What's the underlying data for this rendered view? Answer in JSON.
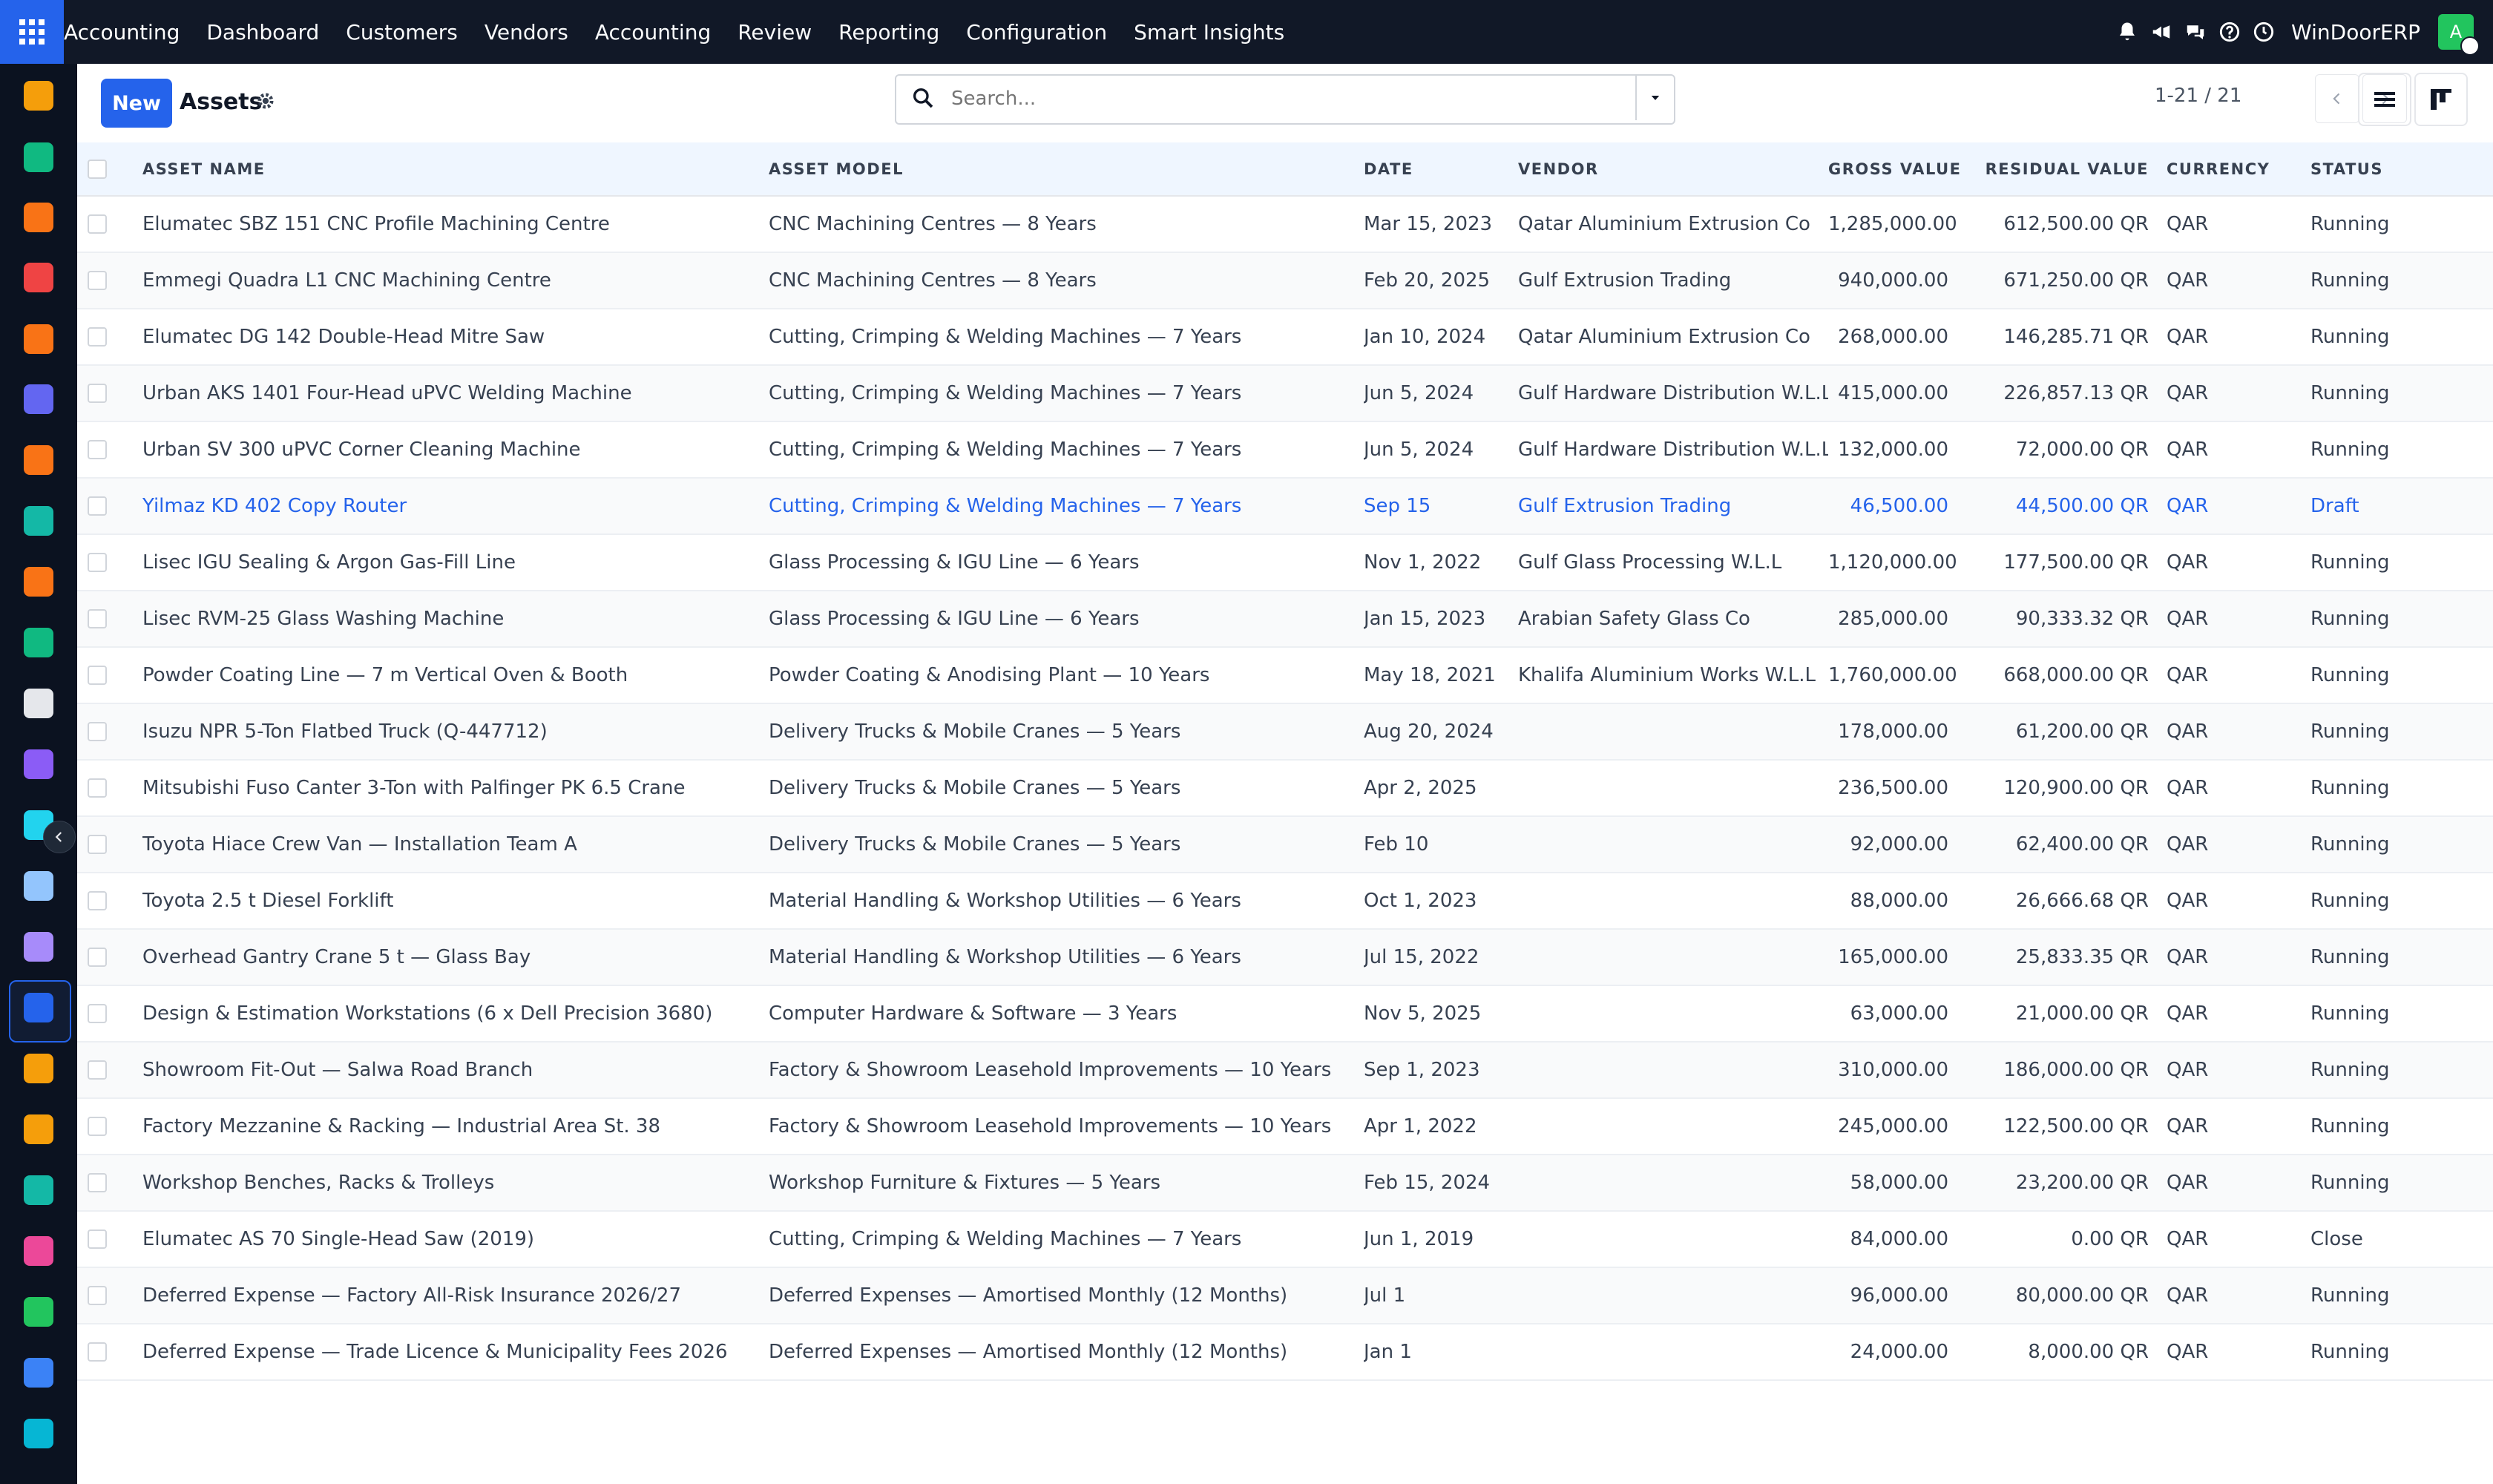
{
  "topbar": {
    "app_title": "Accounting",
    "menu": [
      "Dashboard",
      "Customers",
      "Vendors",
      "Accounting",
      "Review",
      "Reporting",
      "Configuration",
      "Smart Insights"
    ],
    "icons": [
      "bell-icon",
      "megaphone-icon",
      "chat-icon",
      "help-icon",
      "clock-icon"
    ],
    "company": "WinDoorERP",
    "avatar_initial": "A"
  },
  "colors": {
    "brand": "#2563eb",
    "topbar": "#111827",
    "sidebar": "#0b1220",
    "header_row": "#eff6ff"
  },
  "sidebar": {
    "apps": [
      {
        "name": "app-1",
        "color": "#f59e0b"
      },
      {
        "name": "app-2",
        "color": "#10b981"
      },
      {
        "name": "app-3",
        "color": "#f97316"
      },
      {
        "name": "app-4",
        "color": "#ef4444"
      },
      {
        "name": "app-5",
        "color": "#f97316"
      },
      {
        "name": "app-6",
        "color": "#6366f1"
      },
      {
        "name": "app-7",
        "color": "#f97316"
      },
      {
        "name": "app-8",
        "color": "#14b8a6"
      },
      {
        "name": "app-9",
        "color": "#f97316"
      },
      {
        "name": "app-10",
        "color": "#10b981"
      },
      {
        "name": "app-11",
        "color": "#e5e7eb"
      },
      {
        "name": "app-12",
        "color": "#8b5cf6"
      },
      {
        "name": "app-13",
        "color": "#22d3ee"
      },
      {
        "name": "app-14",
        "color": "#93c5fd"
      },
      {
        "name": "app-15",
        "color": "#a78bfa"
      },
      {
        "name": "accounting-app",
        "color": "#2563eb"
      },
      {
        "name": "app-17",
        "color": "#f59e0b"
      },
      {
        "name": "app-18",
        "color": "#f59e0b"
      },
      {
        "name": "app-19",
        "color": "#14b8a6"
      },
      {
        "name": "app-20",
        "color": "#ec4899"
      },
      {
        "name": "whatsapp-app",
        "color": "#22c55e"
      },
      {
        "name": "app-22",
        "color": "#3b82f6"
      },
      {
        "name": "app-23",
        "color": "#06b6d4"
      }
    ]
  },
  "control": {
    "new_label": "New",
    "title": "Assets",
    "search_placeholder": "Search...",
    "pager": "1-21 / 21"
  },
  "table": {
    "columns": [
      "ASSET NAME",
      "ASSET MODEL",
      "DATE",
      "VENDOR",
      "GROSS VALUE",
      "RESIDUAL VALUE",
      "CURRENCY",
      "STATUS"
    ],
    "rows": [
      {
        "name": "Elumatec SBZ 151 CNC Profile Machining Centre",
        "model": "CNC Machining Centres — 8 Years",
        "date": "Mar 15, 2023",
        "vendor": "Qatar Aluminium Extrusion Co",
        "gross": "1,285,000.00",
        "residual": "612,500.00 QR",
        "currency": "QAR",
        "status": "Running"
      },
      {
        "name": "Emmegi Quadra L1 CNC Machining Centre",
        "model": "CNC Machining Centres — 8 Years",
        "date": "Feb 20, 2025",
        "vendor": "Gulf Extrusion Trading",
        "gross": "940,000.00",
        "residual": "671,250.00 QR",
        "currency": "QAR",
        "status": "Running"
      },
      {
        "name": "Elumatec DG 142 Double-Head Mitre Saw",
        "model": "Cutting, Crimping & Welding Machines — 7 Years",
        "date": "Jan 10, 2024",
        "vendor": "Qatar Aluminium Extrusion Co",
        "gross": "268,000.00",
        "residual": "146,285.71 QR",
        "currency": "QAR",
        "status": "Running"
      },
      {
        "name": "Urban AKS 1401 Four-Head uPVC Welding Machine",
        "model": "Cutting, Crimping & Welding Machines — 7 Years",
        "date": "Jun 5, 2024",
        "vendor": "Gulf Hardware Distribution W.L.L",
        "gross": "415,000.00",
        "residual": "226,857.13 QR",
        "currency": "QAR",
        "status": "Running"
      },
      {
        "name": "Urban SV 300 uPVC Corner Cleaning Machine",
        "model": "Cutting, Crimping & Welding Machines — 7 Years",
        "date": "Jun 5, 2024",
        "vendor": "Gulf Hardware Distribution W.L.L",
        "gross": "132,000.00",
        "residual": "72,000.00 QR",
        "currency": "QAR",
        "status": "Running"
      },
      {
        "name": "Yilmaz KD 402 Copy Router",
        "model": "Cutting, Crimping & Welding Machines — 7 Years",
        "date": "Sep 15",
        "vendor": "Gulf Extrusion Trading",
        "gross": "46,500.00",
        "residual": "44,500.00 QR",
        "currency": "QAR",
        "status": "Draft"
      },
      {
        "name": "Lisec IGU Sealing & Argon Gas-Fill Line",
        "model": "Glass Processing & IGU Line — 6 Years",
        "date": "Nov 1, 2022",
        "vendor": "Gulf Glass Processing W.L.L",
        "gross": "1,120,000.00",
        "residual": "177,500.00 QR",
        "currency": "QAR",
        "status": "Running"
      },
      {
        "name": "Lisec RVM-25 Glass Washing Machine",
        "model": "Glass Processing & IGU Line — 6 Years",
        "date": "Jan 15, 2023",
        "vendor": "Arabian Safety Glass Co",
        "gross": "285,000.00",
        "residual": "90,333.32 QR",
        "currency": "QAR",
        "status": "Running"
      },
      {
        "name": "Powder Coating Line — 7 m Vertical Oven & Booth",
        "model": "Powder Coating & Anodising Plant — 10 Years",
        "date": "May 18, 2021",
        "vendor": "Khalifa Aluminium Works W.L.L",
        "gross": "1,760,000.00",
        "residual": "668,000.00 QR",
        "currency": "QAR",
        "status": "Running"
      },
      {
        "name": "Isuzu NPR 5-Ton Flatbed Truck (Q-447712)",
        "model": "Delivery Trucks & Mobile Cranes — 5 Years",
        "date": "Aug 20, 2024",
        "vendor": "",
        "gross": "178,000.00",
        "residual": "61,200.00 QR",
        "currency": "QAR",
        "status": "Running"
      },
      {
        "name": "Mitsubishi Fuso Canter 3-Ton with Palfinger PK 6.5 Crane",
        "model": "Delivery Trucks & Mobile Cranes — 5 Years",
        "date": "Apr 2, 2025",
        "vendor": "",
        "gross": "236,500.00",
        "residual": "120,900.00 QR",
        "currency": "QAR",
        "status": "Running"
      },
      {
        "name": "Toyota Hiace Crew Van — Installation Team A",
        "model": "Delivery Trucks & Mobile Cranes — 5 Years",
        "date": "Feb 10",
        "vendor": "",
        "gross": "92,000.00",
        "residual": "62,400.00 QR",
        "currency": "QAR",
        "status": "Running"
      },
      {
        "name": "Toyota 2.5 t Diesel Forklift",
        "model": "Material Handling & Workshop Utilities — 6 Years",
        "date": "Oct 1, 2023",
        "vendor": "",
        "gross": "88,000.00",
        "residual": "26,666.68 QR",
        "currency": "QAR",
        "status": "Running"
      },
      {
        "name": "Overhead Gantry Crane 5 t — Glass Bay",
        "model": "Material Handling & Workshop Utilities — 6 Years",
        "date": "Jul 15, 2022",
        "vendor": "",
        "gross": "165,000.00",
        "residual": "25,833.35 QR",
        "currency": "QAR",
        "status": "Running"
      },
      {
        "name": "Design & Estimation Workstations (6 x Dell Precision 3680)",
        "model": "Computer Hardware & Software — 3 Years",
        "date": "Nov 5, 2025",
        "vendor": "",
        "gross": "63,000.00",
        "residual": "21,000.00 QR",
        "currency": "QAR",
        "status": "Running"
      },
      {
        "name": "Showroom Fit-Out — Salwa Road Branch",
        "model": "Factory & Showroom Leasehold Improvements — 10 Years",
        "date": "Sep 1, 2023",
        "vendor": "",
        "gross": "310,000.00",
        "residual": "186,000.00 QR",
        "currency": "QAR",
        "status": "Running"
      },
      {
        "name": "Factory Mezzanine & Racking — Industrial Area St. 38",
        "model": "Factory & Showroom Leasehold Improvements — 10 Years",
        "date": "Apr 1, 2022",
        "vendor": "",
        "gross": "245,000.00",
        "residual": "122,500.00 QR",
        "currency": "QAR",
        "status": "Running"
      },
      {
        "name": "Workshop Benches, Racks & Trolleys",
        "model": "Workshop Furniture & Fixtures — 5 Years",
        "date": "Feb 15, 2024",
        "vendor": "",
        "gross": "58,000.00",
        "residual": "23,200.00 QR",
        "currency": "QAR",
        "status": "Running"
      },
      {
        "name": "Elumatec AS 70 Single-Head Saw (2019)",
        "model": "Cutting, Crimping & Welding Machines — 7 Years",
        "date": "Jun 1, 2019",
        "vendor": "",
        "gross": "84,000.00",
        "residual": "0.00 QR",
        "currency": "QAR",
        "status": "Close"
      },
      {
        "name": "Deferred Expense — Factory All-Risk Insurance 2026/27",
        "model": "Deferred Expenses — Amortised Monthly (12 Months)",
        "date": "Jul 1",
        "vendor": "",
        "gross": "96,000.00",
        "residual": "80,000.00 QR",
        "currency": "QAR",
        "status": "Running"
      },
      {
        "name": "Deferred Expense — Trade Licence & Municipality Fees 2026",
        "model": "Deferred Expenses — Amortised Monthly (12 Months)",
        "date": "Jan 1",
        "vendor": "",
        "gross": "24,000.00",
        "residual": "8,000.00 QR",
        "currency": "QAR",
        "status": "Running"
      }
    ]
  }
}
